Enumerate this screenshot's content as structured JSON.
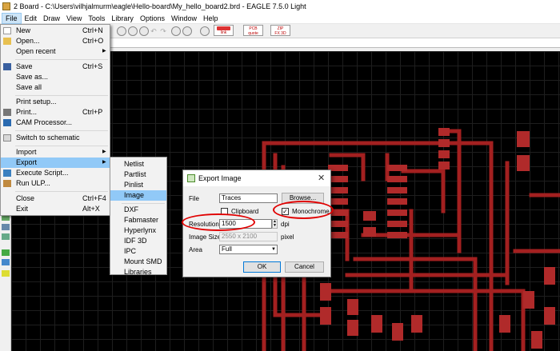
{
  "window": {
    "title": "2 Board - C:\\Users\\vilhjalmurm\\eagle\\Hello-board\\My_hello_board2.brd - EAGLE 7.5.0 Light"
  },
  "menubar": {
    "items": [
      "File",
      "Edit",
      "Draw",
      "View",
      "Tools",
      "Library",
      "Options",
      "Window",
      "Help"
    ]
  },
  "toolbar_badges": [
    {
      "top": "design",
      "bottom": "link"
    },
    {
      "top": "PCB",
      "bottom": "quote"
    },
    {
      "top": "ZIP",
      "bottom": "FX 3D"
    }
  ],
  "file_menu": {
    "items": [
      {
        "label": "New",
        "shortcut": "Ctrl+N",
        "icon": "new-file-icon"
      },
      {
        "label": "Open...",
        "shortcut": "Ctrl+O",
        "icon": "open-folder-icon"
      },
      {
        "label": "Open recent",
        "shortcut": "",
        "submenu": true
      },
      {
        "label": "Save",
        "shortcut": "Ctrl+S",
        "icon": "save-icon"
      },
      {
        "label": "Save as...",
        "shortcut": ""
      },
      {
        "label": "Save all",
        "shortcut": ""
      },
      {
        "label": "Print setup...",
        "shortcut": ""
      },
      {
        "label": "Print...",
        "shortcut": "Ctrl+P",
        "icon": "printer-icon"
      },
      {
        "label": "CAM Processor...",
        "shortcut": "",
        "icon": "cam-icon"
      },
      {
        "label": "Switch to schematic",
        "shortcut": "",
        "icon": "schematic-icon"
      },
      {
        "label": "Import",
        "shortcut": "",
        "submenu": true
      },
      {
        "label": "Export",
        "shortcut": "",
        "submenu": true,
        "highlighted": true
      },
      {
        "label": "Execute Script...",
        "shortcut": "",
        "icon": "script-icon"
      },
      {
        "label": "Run ULP...",
        "shortcut": "",
        "icon": "ulp-icon"
      },
      {
        "label": "Close",
        "shortcut": "Ctrl+F4"
      },
      {
        "label": "Exit",
        "shortcut": "Alt+X"
      }
    ]
  },
  "export_submenu": {
    "items": [
      "Netlist",
      "Partlist",
      "Pinlist",
      "Image",
      "DXF",
      "Fabmaster",
      "Hyperlynx",
      "IDF 3D",
      "IPC",
      "Mount SMD",
      "Libraries"
    ],
    "highlighted": "Image"
  },
  "dialog": {
    "title": "Export Image",
    "file_label": "File",
    "file_value": "Traces",
    "browse_label": "Browse...",
    "clipboard_label": "Clipboard",
    "clipboard_checked": false,
    "monochrome_label": "Monochrome",
    "monochrome_checked": true,
    "resolution_label": "Resolution",
    "resolution_value": "1500",
    "resolution_unit": "dpi",
    "image_size_label": "Image Size",
    "image_size_value": "2550 x 2100",
    "image_size_unit": "pixel",
    "area_label": "Area",
    "area_value": "Full",
    "ok_label": "OK",
    "cancel_label": "Cancel"
  },
  "colors": {
    "trace": "#a32020",
    "pad": "#b02a2a",
    "highlight": "#91c9f7",
    "annotation_ring": "#e00000"
  }
}
